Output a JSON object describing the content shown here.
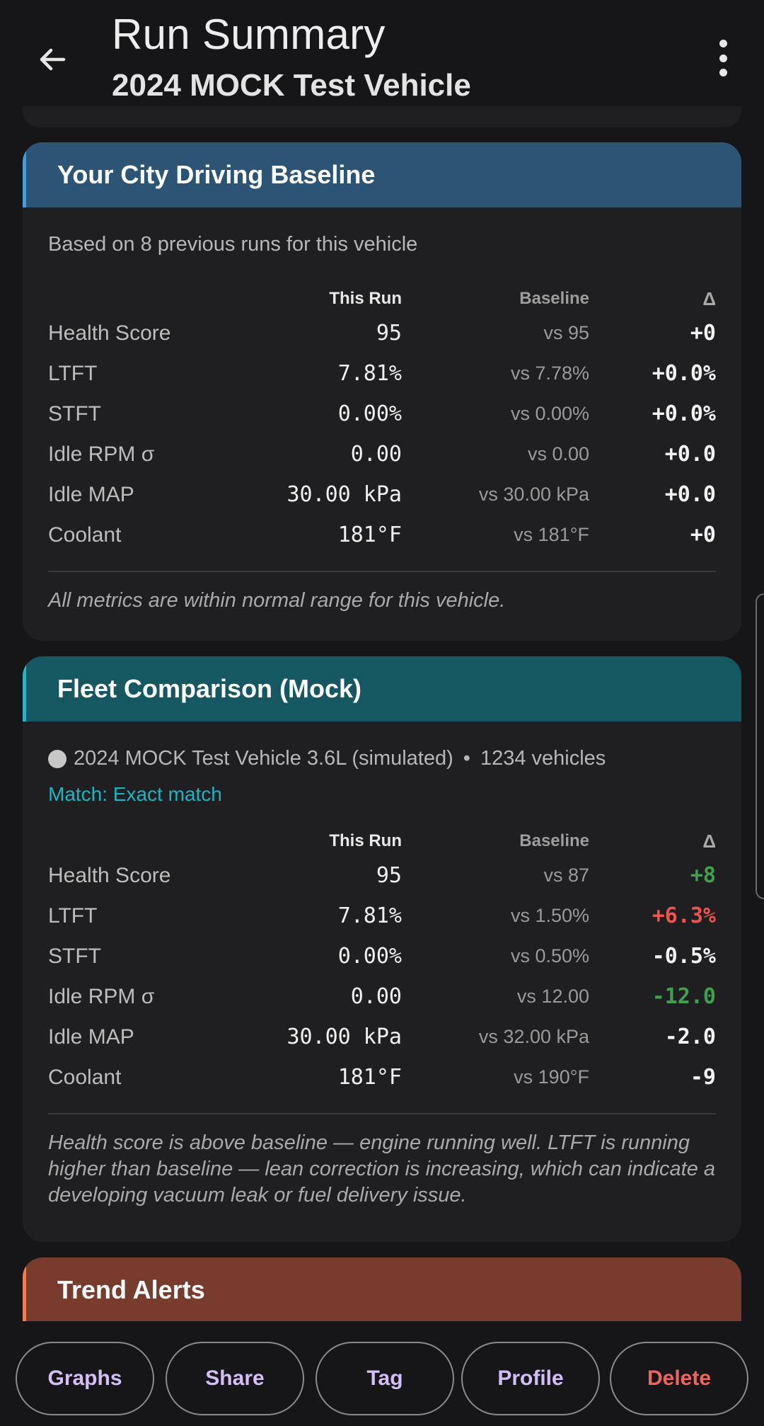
{
  "header": {
    "title": "Run Summary",
    "subtitle": "2024 MOCK Test Vehicle"
  },
  "baseline_card": {
    "title": "Your City Driving Baseline",
    "note": "Based on 8 previous runs for this vehicle",
    "columns": {
      "run": "This Run",
      "base": "Baseline",
      "delta": "Δ"
    },
    "rows": [
      {
        "label": "Health Score",
        "run": "95",
        "base": "vs 95",
        "delta": "+0",
        "delta_color": "#f3f3f3"
      },
      {
        "label": "LTFT",
        "run": "7.81%",
        "base": "vs 7.78%",
        "delta": "+0.0%",
        "delta_color": "#f3f3f3"
      },
      {
        "label": "STFT",
        "run": "0.00%",
        "base": "vs 0.00%",
        "delta": "+0.0%",
        "delta_color": "#f3f3f3"
      },
      {
        "label": "Idle RPM σ",
        "run": "0.00",
        "base": "vs 0.00",
        "delta": "+0.0",
        "delta_color": "#f3f3f3"
      },
      {
        "label": "Idle MAP",
        "run": "30.00 kPa",
        "base": "vs 30.00 kPa",
        "delta": "+0.0",
        "delta_color": "#f3f3f3"
      },
      {
        "label": "Coolant",
        "run": "181°F",
        "base": "vs 181°F",
        "delta": "+0",
        "delta_color": "#f3f3f3"
      }
    ],
    "footnote": "All metrics are within normal range for this vehicle."
  },
  "fleet_card": {
    "title": "Fleet Comparison (Mock)",
    "vehicle": "2024 MOCK Test Vehicle 3.6L (simulated)",
    "separator": "•",
    "count": "1234 vehicles",
    "match": "Match: Exact match",
    "columns": {
      "run": "This Run",
      "base": "Baseline",
      "delta": "Δ"
    },
    "rows": [
      {
        "label": "Health Score",
        "run": "95",
        "base": "vs 87",
        "delta": "+8",
        "delta_color": "#3fa14a"
      },
      {
        "label": "LTFT",
        "run": "7.81%",
        "base": "vs 1.50%",
        "delta": "+6.3%",
        "delta_color": "#ef5350"
      },
      {
        "label": "STFT",
        "run": "0.00%",
        "base": "vs 0.50%",
        "delta": "-0.5%",
        "delta_color": "#f3f3f3"
      },
      {
        "label": "Idle RPM σ",
        "run": "0.00",
        "base": "vs 12.00",
        "delta": "-12.0",
        "delta_color": "#3fa14a"
      },
      {
        "label": "Idle MAP",
        "run": "30.00 kPa",
        "base": "vs 32.00 kPa",
        "delta": "-2.0",
        "delta_color": "#f3f3f3"
      },
      {
        "label": "Coolant",
        "run": "181°F",
        "base": "vs 190°F",
        "delta": "-9",
        "delta_color": "#f3f3f3"
      }
    ],
    "footnote": "Health score is above baseline — engine running well. LTFT is running higher than baseline — lean correction is increasing, which can indicate a developing vacuum leak or fuel delivery issue."
  },
  "trend_card": {
    "title": "Trend Alerts"
  },
  "actions": {
    "graphs": "Graphs",
    "share": "Share",
    "tag": "Tag",
    "profile": "Profile",
    "delete": "Delete"
  },
  "colors": {
    "baseline_header": "#2b5475",
    "fleet_header": "#155862",
    "trend_header": "#773c2c",
    "positive": "#3fa14a",
    "negative": "#ef5350",
    "action_text": "#d3bff5",
    "delete_text": "#ef6360"
  },
  "icons": {
    "back": "arrow-left-icon",
    "more": "more-vert-icon"
  }
}
